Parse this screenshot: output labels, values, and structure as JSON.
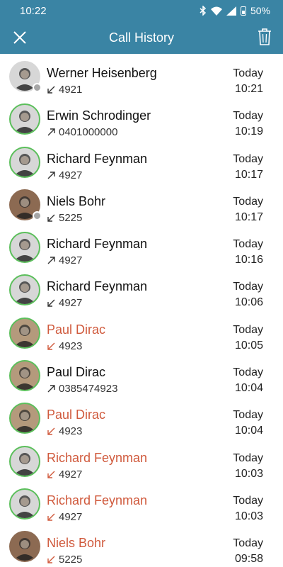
{
  "status_bar": {
    "time": "10:22",
    "battery": "50%"
  },
  "app_bar": {
    "title": "Call History"
  },
  "calls": [
    {
      "name": "Werner Heisenberg",
      "number": "4921",
      "direction": "incoming",
      "missed": false,
      "ring": false,
      "status_dot": true,
      "day": "Today",
      "time": "10:21"
    },
    {
      "name": "Erwin Schrodinger",
      "number": "0401000000",
      "direction": "outgoing",
      "missed": false,
      "ring": true,
      "status_dot": false,
      "day": "Today",
      "time": "10:19"
    },
    {
      "name": "Richard Feynman",
      "number": "4927",
      "direction": "outgoing",
      "missed": false,
      "ring": true,
      "status_dot": false,
      "day": "Today",
      "time": "10:17"
    },
    {
      "name": "Niels Bohr",
      "number": "5225",
      "direction": "incoming",
      "missed": false,
      "ring": false,
      "status_dot": true,
      "day": "Today",
      "time": "10:17"
    },
    {
      "name": "Richard Feynman",
      "number": "4927",
      "direction": "outgoing",
      "missed": false,
      "ring": true,
      "status_dot": false,
      "day": "Today",
      "time": "10:16"
    },
    {
      "name": "Richard Feynman",
      "number": "4927",
      "direction": "incoming",
      "missed": false,
      "ring": true,
      "status_dot": false,
      "day": "Today",
      "time": "10:06"
    },
    {
      "name": "Paul Dirac",
      "number": "4923",
      "direction": "incoming",
      "missed": true,
      "ring": true,
      "status_dot": false,
      "day": "Today",
      "time": "10:05"
    },
    {
      "name": "Paul Dirac",
      "number": "0385474923",
      "direction": "outgoing",
      "missed": false,
      "ring": true,
      "status_dot": false,
      "day": "Today",
      "time": "10:04"
    },
    {
      "name": "Paul Dirac",
      "number": "4923",
      "direction": "incoming",
      "missed": true,
      "ring": true,
      "status_dot": false,
      "day": "Today",
      "time": "10:04"
    },
    {
      "name": "Richard Feynman",
      "number": "4927",
      "direction": "incoming",
      "missed": true,
      "ring": true,
      "status_dot": false,
      "day": "Today",
      "time": "10:03"
    },
    {
      "name": "Richard Feynman",
      "number": "4927",
      "direction": "incoming",
      "missed": true,
      "ring": true,
      "status_dot": false,
      "day": "Today",
      "time": "10:03"
    },
    {
      "name": "Niels Bohr",
      "number": "5225",
      "direction": "incoming",
      "missed": true,
      "ring": false,
      "status_dot": false,
      "day": "Today",
      "time": "09:58"
    }
  ]
}
